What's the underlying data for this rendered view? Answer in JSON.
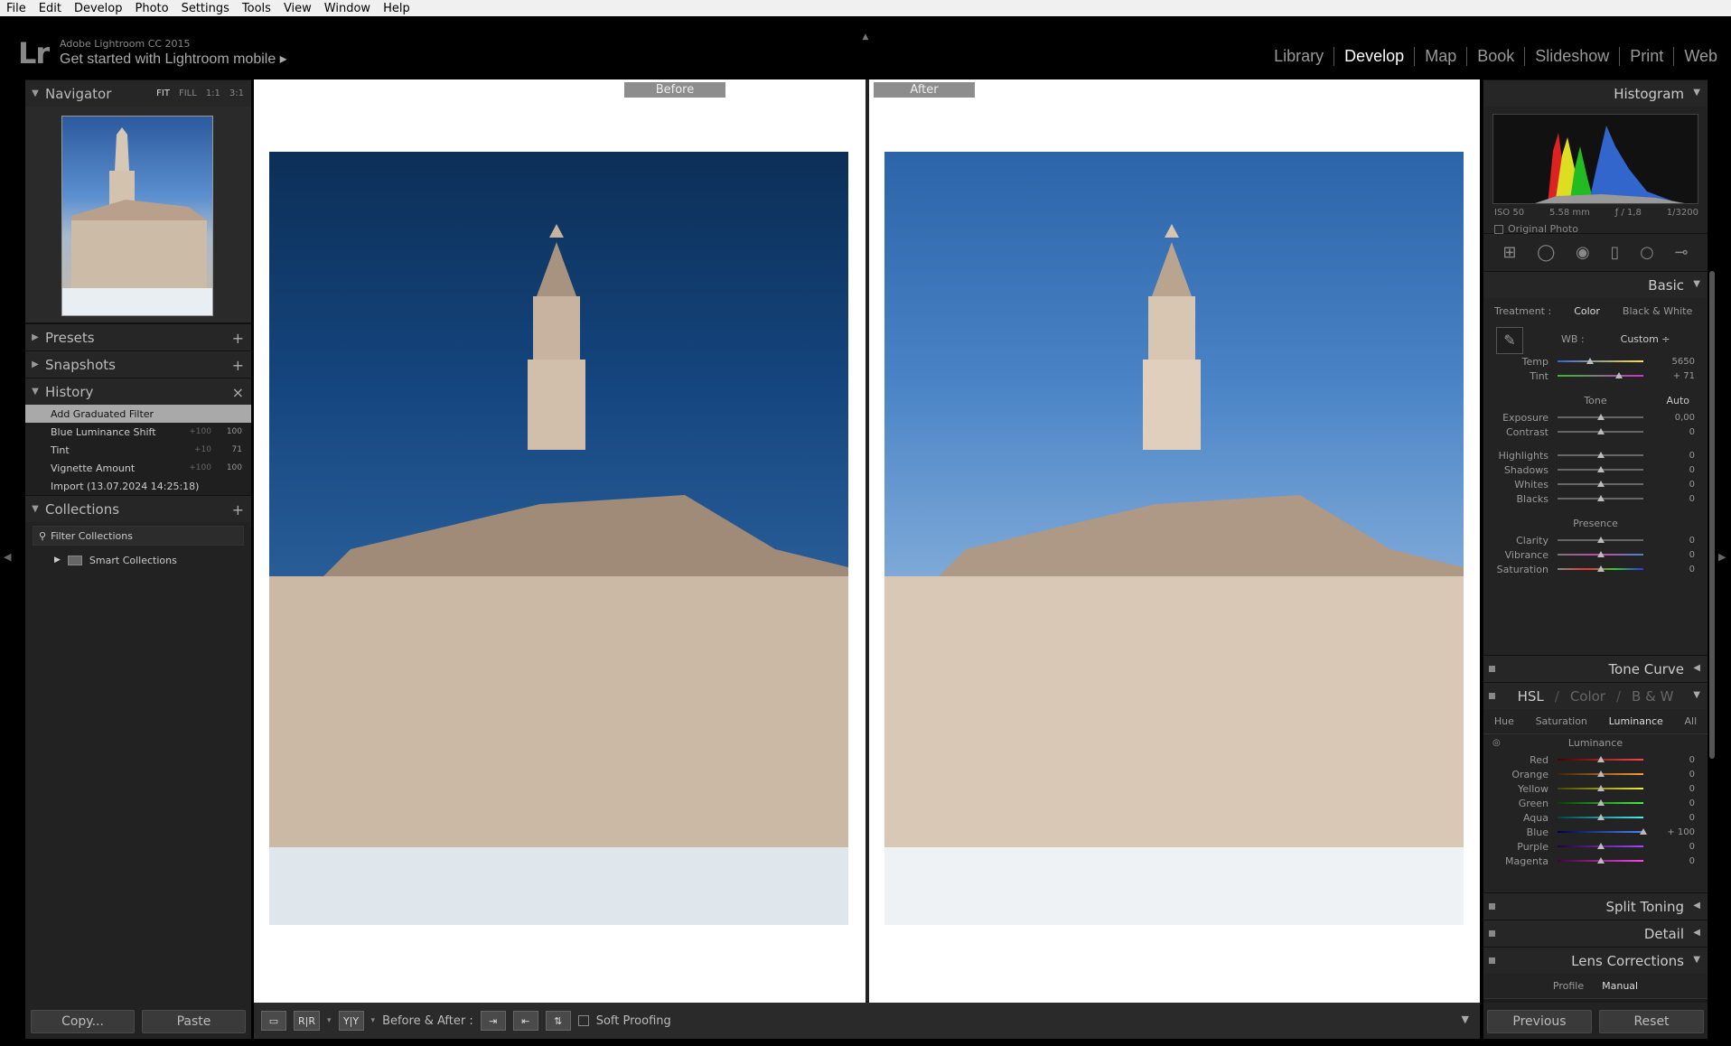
{
  "menu": [
    "File",
    "Edit",
    "Develop",
    "Photo",
    "Settings",
    "Tools",
    "View",
    "Window",
    "Help"
  ],
  "app": {
    "logo": "Lr",
    "name": "Adobe Lightroom CC 2015",
    "mobile": "Get started with Lightroom mobile ▸"
  },
  "modules": [
    "Library",
    "Develop",
    "Map",
    "Book",
    "Slideshow",
    "Print",
    "Web"
  ],
  "left": {
    "navigator": "Navigator",
    "nav_modes": [
      "FIT",
      "FILL",
      "1:1",
      "3:1"
    ],
    "presets": "Presets",
    "snapshots": "Snapshots",
    "history": "History",
    "history_items": [
      {
        "label": "Add Graduated Filter",
        "v1": "",
        "v2": ""
      },
      {
        "label": "Blue Luminance Shift",
        "v1": "+100",
        "v2": "100"
      },
      {
        "label": "Tint",
        "v1": "+10",
        "v2": "71"
      },
      {
        "label": "Vignette Amount",
        "v1": "+100",
        "v2": "100"
      },
      {
        "label": "Import (13.07.2024 14:25:18)",
        "v1": "",
        "v2": ""
      }
    ],
    "collections": "Collections",
    "filter": "Filter Collections",
    "smart": "Smart Collections",
    "copy": "Copy...",
    "paste": "Paste"
  },
  "center": {
    "before": "Before",
    "after": "After"
  },
  "toolbar": {
    "view_y": "Y|Y",
    "label": "Before & After :",
    "soft": "Soft Proofing"
  },
  "right": {
    "histogram": "Histogram",
    "iso": "ISO 50",
    "focal": "5.58 mm",
    "aperture": "ƒ / 1,8",
    "shutter": "1/3200",
    "original": "Original Photo",
    "basic": "Basic",
    "treatment": "Treatment :",
    "color": "Color",
    "bw": "Black & White",
    "wb": "WB :",
    "wb_val": "Custom ÷",
    "sliders_wb": [
      {
        "label": "Temp",
        "val": "5650",
        "pos": 0.38,
        "grad": "linear-gradient(90deg,#36c,#fd4)"
      },
      {
        "label": "Tint",
        "val": "+ 71",
        "pos": 0.72,
        "grad": "linear-gradient(90deg,#3b3,#c3c)"
      }
    ],
    "tone": "Tone",
    "auto": "Auto",
    "sliders_tone": [
      {
        "label": "Exposure",
        "val": "0,00",
        "pos": 0.5
      },
      {
        "label": "Contrast",
        "val": "0",
        "pos": 0.5
      }
    ],
    "sliders_tone2": [
      {
        "label": "Highlights",
        "val": "0",
        "pos": 0.5
      },
      {
        "label": "Shadows",
        "val": "0",
        "pos": 0.5
      },
      {
        "label": "Whites",
        "val": "0",
        "pos": 0.5
      },
      {
        "label": "Blacks",
        "val": "0",
        "pos": 0.5
      }
    ],
    "presence": "Presence",
    "sliders_presence": [
      {
        "label": "Clarity",
        "val": "0",
        "pos": 0.5
      },
      {
        "label": "Vibrance",
        "val": "0",
        "pos": 0.5,
        "grad": "linear-gradient(90deg,#777,#c4a,#48c)"
      },
      {
        "label": "Saturation",
        "val": "0",
        "pos": 0.5,
        "grad": "linear-gradient(90deg,#888,#e33,#3c3,#33e)"
      }
    ],
    "tone_curve": "Tone Curve",
    "hsl": "HSL",
    "hsl_color": "Color",
    "hsl_bw": "B & W",
    "hsl_tabs": [
      "Hue",
      "Saturation",
      "Luminance",
      "All"
    ],
    "luminance": "Luminance",
    "sliders_lum": [
      {
        "label": "Red",
        "val": "0",
        "pos": 0.5,
        "grad": "linear-gradient(90deg,#400,#f44)"
      },
      {
        "label": "Orange",
        "val": "0",
        "pos": 0.5,
        "grad": "linear-gradient(90deg,#420,#f93)"
      },
      {
        "label": "Yellow",
        "val": "0",
        "pos": 0.5,
        "grad": "linear-gradient(90deg,#440,#ee3)"
      },
      {
        "label": "Green",
        "val": "0",
        "pos": 0.5,
        "grad": "linear-gradient(90deg,#040,#4e4)"
      },
      {
        "label": "Aqua",
        "val": "0",
        "pos": 0.5,
        "grad": "linear-gradient(90deg,#044,#4ee)"
      },
      {
        "label": "Blue",
        "val": "+ 100",
        "pos": 1.0,
        "grad": "linear-gradient(90deg,#004,#48f)"
      },
      {
        "label": "Purple",
        "val": "0",
        "pos": 0.5,
        "grad": "linear-gradient(90deg,#204,#a4f)"
      },
      {
        "label": "Magenta",
        "val": "0",
        "pos": 0.5,
        "grad": "linear-gradient(90deg,#404,#f4e)"
      }
    ],
    "split": "Split Toning",
    "detail": "Detail",
    "lens": "Lens Corrections",
    "lens_tabs": [
      "Profile",
      "Manual"
    ],
    "previous": "Previous",
    "reset": "Reset"
  }
}
